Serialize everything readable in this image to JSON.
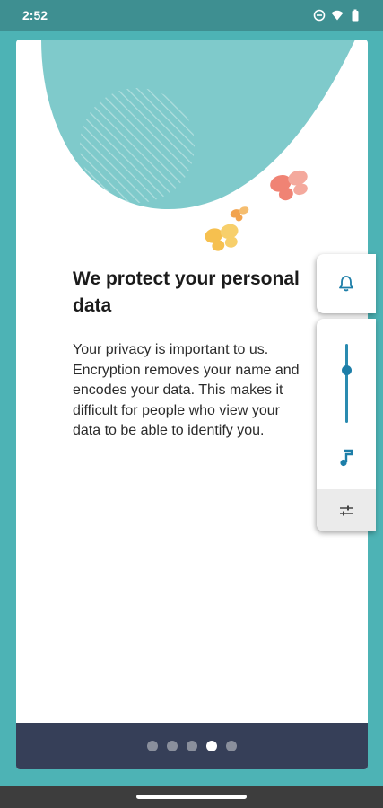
{
  "status_bar": {
    "time": "2:52",
    "icons": [
      "do-not-disturb-icon",
      "wifi-icon",
      "battery-icon"
    ]
  },
  "onboarding": {
    "title": "We protect your personal data",
    "body": "Your privacy is important to us. Encryption removes your name and encodes your data. This makes it difficult for people who view your data to be able to identify you.",
    "page_count": 5,
    "current_page": 4
  },
  "volume_panel": {
    "ringer_icon": "bell-icon",
    "media_icon": "music-note-icon",
    "settings_icon": "sliders-icon",
    "media_level": 0.67
  },
  "colors": {
    "background": "#4db3b5",
    "status_bar": "#3e8f91",
    "hero_shape": "#7fcacb",
    "footer": "#363f58",
    "accent": "#1d7ea8"
  }
}
